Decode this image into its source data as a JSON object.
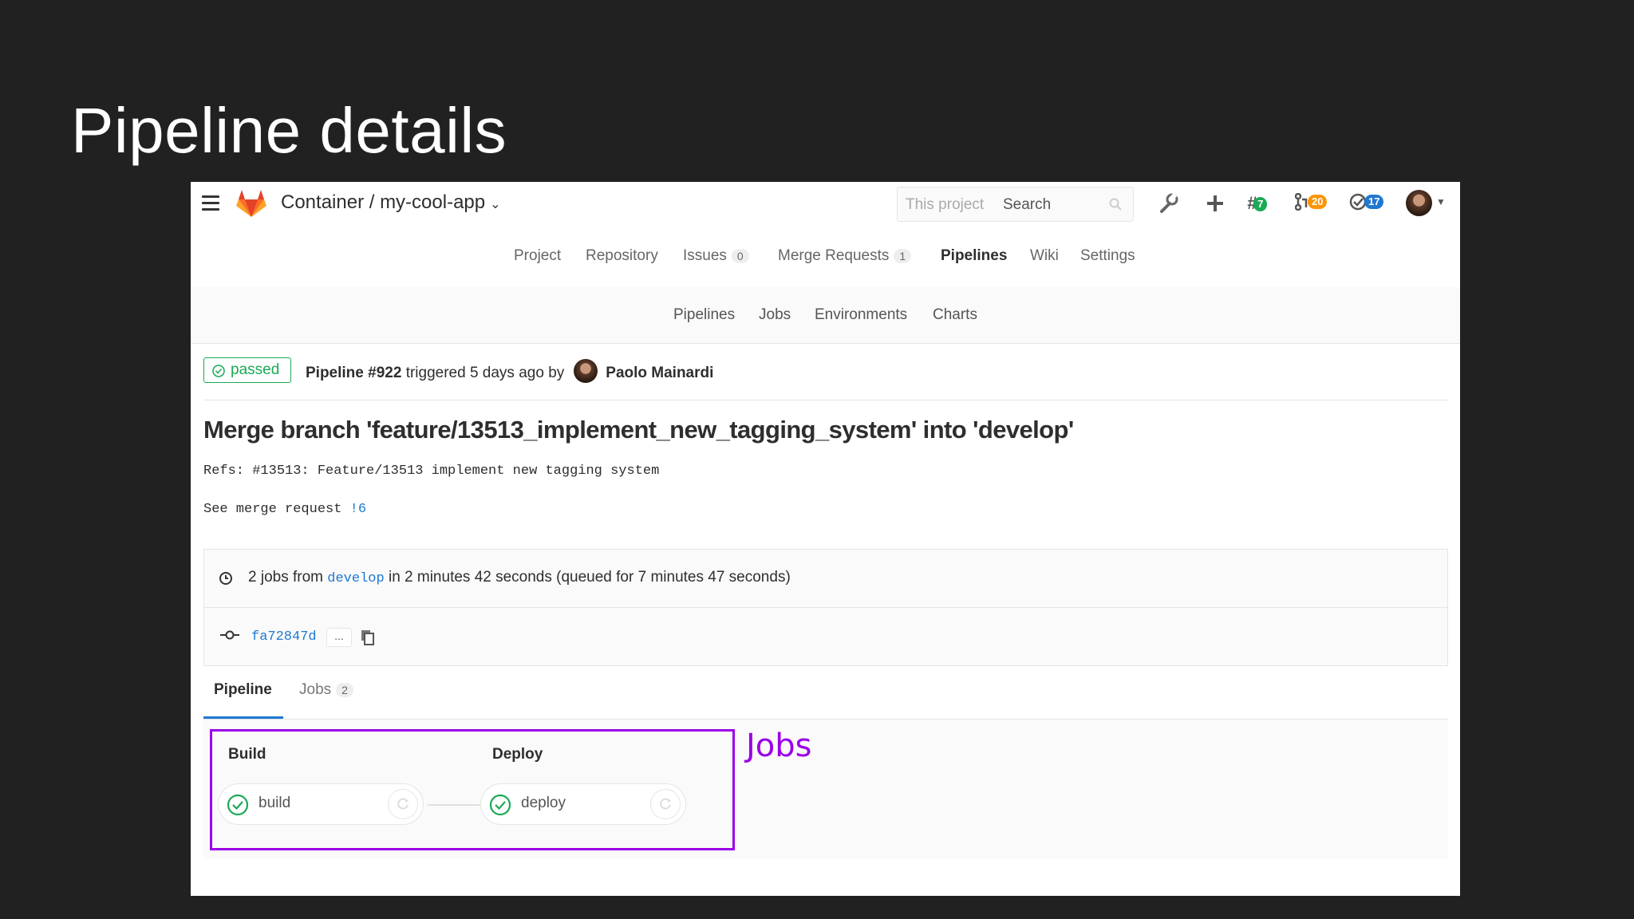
{
  "slide": {
    "title": "Pipeline details"
  },
  "header": {
    "project_path": "Container / my-cool-app",
    "search_scope": "This project",
    "search_placeholder": "Search",
    "todo_count": "7",
    "mr_count": "20",
    "issues_count": "17"
  },
  "nav": {
    "items": [
      {
        "label": "Project"
      },
      {
        "label": "Repository"
      },
      {
        "label": "Issues",
        "count": "0"
      },
      {
        "label": "Merge Requests",
        "count": "1"
      },
      {
        "label": "Pipelines"
      },
      {
        "label": "Wiki"
      },
      {
        "label": "Settings"
      }
    ],
    "active": "Pipelines"
  },
  "subnav": {
    "items": [
      {
        "label": "Pipelines"
      },
      {
        "label": "Jobs"
      },
      {
        "label": "Environments"
      },
      {
        "label": "Charts"
      }
    ]
  },
  "pipeline": {
    "status": "passed",
    "id": "Pipeline #922",
    "triggered_text": "triggered 5 days ago by",
    "author": "Paolo Mainardi",
    "commit_title": "Merge branch 'feature/13513_implement_new_tagging_system' into 'develop'",
    "refs": "Refs: #13513: Feature/13513 implement new tagging system",
    "mr_prefix": "See merge request",
    "mr_link": "!6",
    "info_prefix": "2 jobs from",
    "branch": "develop",
    "info_suffix": "in 2 minutes 42 seconds (queued for 7 minutes 47 seconds)",
    "sha": "fa72847d",
    "ellipsis": "...",
    "accent_color": "#1f78d1",
    "success_color": "#1aaa55"
  },
  "tabs": [
    {
      "label": "Pipeline"
    },
    {
      "label": "Jobs",
      "count": "2"
    }
  ],
  "graph": {
    "stages": [
      {
        "title": "Build",
        "job": "build",
        "status": "passed"
      },
      {
        "title": "Deploy",
        "job": "deploy",
        "status": "passed"
      }
    ]
  },
  "annotation": {
    "label": "Jobs",
    "color": "#9b00e8"
  }
}
